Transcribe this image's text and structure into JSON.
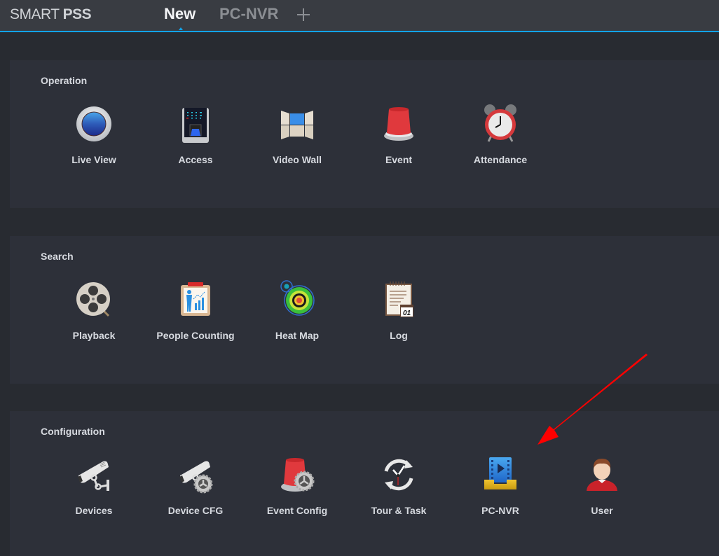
{
  "app": {
    "brand_light": "SMART ",
    "brand_bold": "PSS"
  },
  "tabs": [
    {
      "label": "New",
      "active": true
    },
    {
      "label": "PC-NVR",
      "active": false
    }
  ],
  "add_tab_icon": "plus-icon",
  "sections": [
    {
      "title": "Operation",
      "items": [
        {
          "label": "Live View",
          "icon": "live-view-icon"
        },
        {
          "label": "Access",
          "icon": "access-control-icon"
        },
        {
          "label": "Video Wall",
          "icon": "video-wall-icon"
        },
        {
          "label": "Event",
          "icon": "alarm-light-icon"
        },
        {
          "label": "Attendance",
          "icon": "alarm-clock-icon"
        }
      ]
    },
    {
      "title": "Search",
      "items": [
        {
          "label": "Playback",
          "icon": "film-reel-icon"
        },
        {
          "label": "People Counting",
          "icon": "people-counting-icon"
        },
        {
          "label": "Heat Map",
          "icon": "heat-map-icon"
        },
        {
          "label": "Log",
          "icon": "log-notepad-icon"
        }
      ]
    },
    {
      "title": "Configuration",
      "items": [
        {
          "label": "Devices",
          "icon": "camera-icon"
        },
        {
          "label": "Device CFG",
          "icon": "camera-gear-icon"
        },
        {
          "label": "Event Config",
          "icon": "alarm-gear-icon"
        },
        {
          "label": "Tour & Task",
          "icon": "clock-cycle-icon"
        },
        {
          "label": "PC-NVR",
          "icon": "pc-nvr-icon"
        },
        {
          "label": "User",
          "icon": "user-icon"
        }
      ]
    }
  ],
  "log_icon_text": "01",
  "annotation": {
    "type": "arrow",
    "color": "#ff0000",
    "points_to": "PC-NVR"
  },
  "colors": {
    "accent": "#12a3e8",
    "panel": "#2d3039",
    "background": "#282b31",
    "topbar": "#393c42"
  }
}
